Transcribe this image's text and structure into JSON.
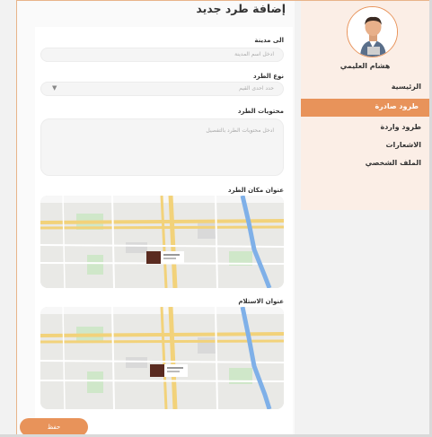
{
  "page": {
    "title": "إضافة طرد جديد"
  },
  "form": {
    "city_label": "الى مدينة",
    "city_placeholder": "ادخل اسم المدينة",
    "type_label": "نوع الطرد",
    "type_placeholder": "حدد احدى القيم",
    "contents_label": "محتويات الطرد",
    "contents_placeholder": "ادخل محتويات الطرد بالتفصيل",
    "sender_address_label": "عنوان مكان الطرد",
    "receive_address_label": "عنوان الاستلام",
    "save_label": "حفظ"
  },
  "sidebar": {
    "user_name": "هشام العليمي",
    "items": [
      {
        "label": "الرئيسية",
        "active": false
      },
      {
        "label": "طرود صادرة",
        "active": true
      },
      {
        "label": "طرود واردة",
        "active": false
      },
      {
        "label": "الاشعارات",
        "active": false
      },
      {
        "label": "الملف الشخصي",
        "active": false
      }
    ]
  },
  "colors": {
    "accent": "#e8935a",
    "sidebar_bg": "#fbeee6"
  }
}
